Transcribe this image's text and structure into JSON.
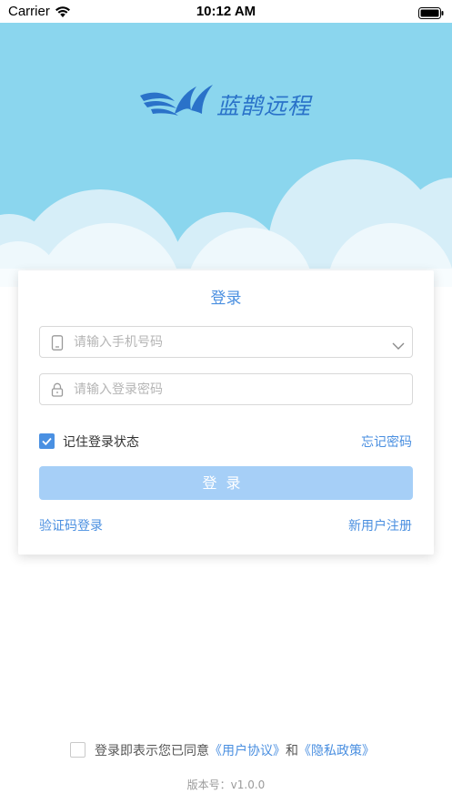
{
  "status_bar": {
    "carrier": "Carrier",
    "time": "10:12 AM"
  },
  "brand": {
    "name": "蓝鹊远程",
    "color": "#2a72c9",
    "logo_icon": "magpie-wing-logo"
  },
  "login_card": {
    "title": "登录",
    "phone_placeholder": "请输入手机号码",
    "password_placeholder": "请输入登录密码",
    "remember_label": "记住登录状态",
    "remember_checked": true,
    "forgot_password": "忘记密码",
    "login_button": "登录",
    "sms_login": "验证码登录",
    "register": "新用户注册"
  },
  "footer": {
    "agree_prefix": "登录即表示您已同意",
    "user_agreement": "《用户协议》",
    "and": "和",
    "privacy_policy": "《隐私政策》",
    "version": "版本号：v1.0.0"
  },
  "colors": {
    "sky": "#8bd6ee",
    "accent": "#4a8fe0",
    "button_disabled": "#a6cff7"
  }
}
